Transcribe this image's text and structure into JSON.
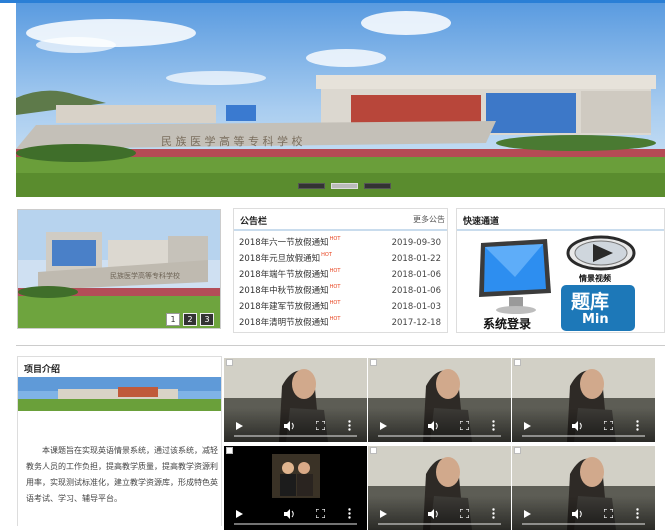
{
  "hero": {
    "campus_sign": "民 族 医 学 高 等 专 科 学 校",
    "slides": [
      {
        "label": "slide 1",
        "active": false
      },
      {
        "label": "slide 2",
        "active": true
      },
      {
        "label": "slide 3",
        "active": false
      }
    ]
  },
  "thumb_slider": {
    "sign": "民族医学高等专科学校",
    "pages": [
      "1",
      "2",
      "3"
    ],
    "active_page": "1"
  },
  "notice": {
    "title": "公告栏",
    "more": "更多公告",
    "hot_badge": "HOT",
    "items": [
      {
        "title": "2018年六一节放假通知",
        "date": "2019-09-30"
      },
      {
        "title": "2018年元旦放假通知",
        "date": "2018-01-22"
      },
      {
        "title": "2018年端午节放假通知",
        "date": "2018-01-06"
      },
      {
        "title": "2018年中秋节放假通知",
        "date": "2018-01-06"
      },
      {
        "title": "2018年建军节放假通知",
        "date": "2018-01-03"
      },
      {
        "title": "2018年清明节放假通知",
        "date": "2017-12-18"
      }
    ]
  },
  "quick": {
    "title": "快速通道",
    "login_label": "系统登录",
    "video_label": "情景视频",
    "bank_label": "题库",
    "bank_sub": "Min"
  },
  "intro": {
    "title": "项目介绍",
    "text": "本课题旨在实现英语情景系统，通过该系统，减轻教务人员的工作负担，提高教学质量，提高教学资源利用率，实现测试标准化，建立教学资源库，形成特色英语考试、学习、辅导平台。"
  },
  "videos": {
    "icons": [
      "play-icon",
      "volume-icon",
      "fullscreen-icon",
      "more-options-icon"
    ]
  },
  "colors": {
    "accent": "#2a7fd6",
    "hot": "#e8431f",
    "bank_bg": "#1d78b8"
  }
}
